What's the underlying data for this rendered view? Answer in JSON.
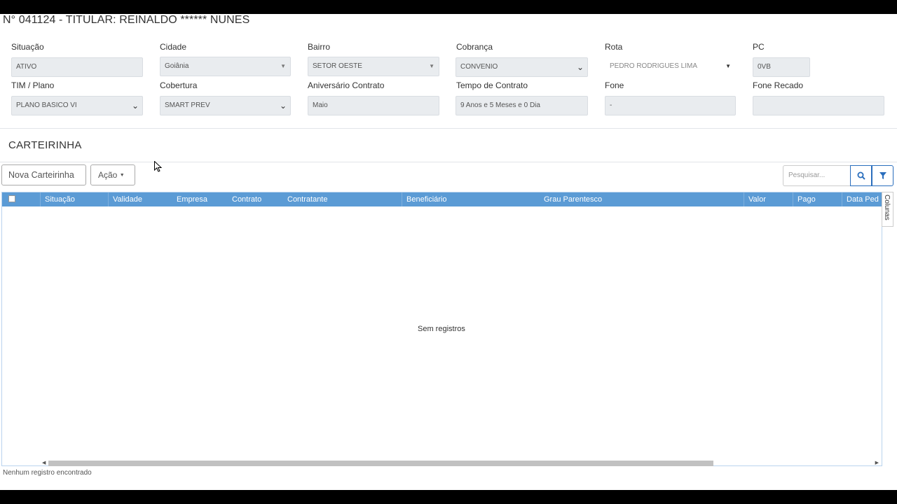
{
  "header": {
    "title": "N° 041124 - TITULAR: REINALDO ****** NUNES"
  },
  "fields": {
    "situacao": {
      "label": "Situação",
      "value": "ATIVO"
    },
    "cidade": {
      "label": "Cidade",
      "value": "Goiânia"
    },
    "bairro": {
      "label": "Bairro",
      "value": "SETOR OESTE"
    },
    "cobranca": {
      "label": "Cobrança",
      "value": "CONVENIO"
    },
    "rota": {
      "label": "Rota",
      "value": "PEDRO RODRIGUES LIMA"
    },
    "pc": {
      "label": "PC",
      "value": "0VB"
    },
    "tim_plano": {
      "label": "TIM / Plano",
      "value": "PLANO BASICO VI"
    },
    "cobertura": {
      "label": "Cobertura",
      "value": "SMART PREV"
    },
    "aniversario": {
      "label": "Aniversário Contrato",
      "value": "Maio"
    },
    "tempo": {
      "label": "Tempo de Contrato",
      "value": "9 Anos e 5 Meses e 0 Dia"
    },
    "fone": {
      "label": "Fone",
      "value": "-"
    },
    "fone_recado": {
      "label": "Fone Recado",
      "value": ""
    }
  },
  "section": {
    "title": "CARTEIRINHA"
  },
  "toolbar": {
    "new_card": "Nova Carteirinha",
    "action": "Ação",
    "search_placeholder": "Pesquisar..."
  },
  "table": {
    "columns": [
      "Situação",
      "Validade",
      "Empresa",
      "Contrato",
      "Contratante",
      "Beneficiário",
      "Grau Parentesco",
      "Valor",
      "Pago",
      "Data Ped"
    ],
    "empty_message": "Sem registros",
    "columns_tab": "Colunas"
  },
  "footer": {
    "status": "Nenhum registro encontrado"
  },
  "icons": {
    "search": "search-icon",
    "filter": "filter-icon"
  },
  "colors": {
    "header_blue": "#5b9bd5",
    "accent": "#2a6ebd"
  }
}
